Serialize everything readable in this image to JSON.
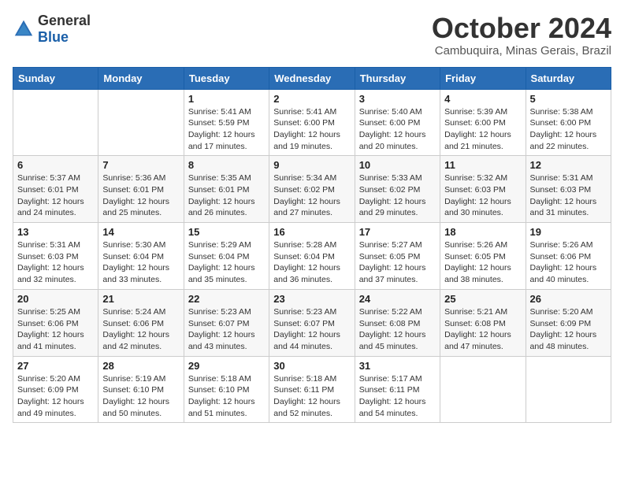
{
  "logo": {
    "general": "General",
    "blue": "Blue"
  },
  "title": "October 2024",
  "location": "Cambuquira, Minas Gerais, Brazil",
  "headers": [
    "Sunday",
    "Monday",
    "Tuesday",
    "Wednesday",
    "Thursday",
    "Friday",
    "Saturday"
  ],
  "weeks": [
    [
      {
        "day": "",
        "detail": ""
      },
      {
        "day": "",
        "detail": ""
      },
      {
        "day": "1",
        "detail": "Sunrise: 5:41 AM\nSunset: 5:59 PM\nDaylight: 12 hours and 17 minutes."
      },
      {
        "day": "2",
        "detail": "Sunrise: 5:41 AM\nSunset: 6:00 PM\nDaylight: 12 hours and 19 minutes."
      },
      {
        "day": "3",
        "detail": "Sunrise: 5:40 AM\nSunset: 6:00 PM\nDaylight: 12 hours and 20 minutes."
      },
      {
        "day": "4",
        "detail": "Sunrise: 5:39 AM\nSunset: 6:00 PM\nDaylight: 12 hours and 21 minutes."
      },
      {
        "day": "5",
        "detail": "Sunrise: 5:38 AM\nSunset: 6:00 PM\nDaylight: 12 hours and 22 minutes."
      }
    ],
    [
      {
        "day": "6",
        "detail": "Sunrise: 5:37 AM\nSunset: 6:01 PM\nDaylight: 12 hours and 24 minutes."
      },
      {
        "day": "7",
        "detail": "Sunrise: 5:36 AM\nSunset: 6:01 PM\nDaylight: 12 hours and 25 minutes."
      },
      {
        "day": "8",
        "detail": "Sunrise: 5:35 AM\nSunset: 6:01 PM\nDaylight: 12 hours and 26 minutes."
      },
      {
        "day": "9",
        "detail": "Sunrise: 5:34 AM\nSunset: 6:02 PM\nDaylight: 12 hours and 27 minutes."
      },
      {
        "day": "10",
        "detail": "Sunrise: 5:33 AM\nSunset: 6:02 PM\nDaylight: 12 hours and 29 minutes."
      },
      {
        "day": "11",
        "detail": "Sunrise: 5:32 AM\nSunset: 6:03 PM\nDaylight: 12 hours and 30 minutes."
      },
      {
        "day": "12",
        "detail": "Sunrise: 5:31 AM\nSunset: 6:03 PM\nDaylight: 12 hours and 31 minutes."
      }
    ],
    [
      {
        "day": "13",
        "detail": "Sunrise: 5:31 AM\nSunset: 6:03 PM\nDaylight: 12 hours and 32 minutes."
      },
      {
        "day": "14",
        "detail": "Sunrise: 5:30 AM\nSunset: 6:04 PM\nDaylight: 12 hours and 33 minutes."
      },
      {
        "day": "15",
        "detail": "Sunrise: 5:29 AM\nSunset: 6:04 PM\nDaylight: 12 hours and 35 minutes."
      },
      {
        "day": "16",
        "detail": "Sunrise: 5:28 AM\nSunset: 6:04 PM\nDaylight: 12 hours and 36 minutes."
      },
      {
        "day": "17",
        "detail": "Sunrise: 5:27 AM\nSunset: 6:05 PM\nDaylight: 12 hours and 37 minutes."
      },
      {
        "day": "18",
        "detail": "Sunrise: 5:26 AM\nSunset: 6:05 PM\nDaylight: 12 hours and 38 minutes."
      },
      {
        "day": "19",
        "detail": "Sunrise: 5:26 AM\nSunset: 6:06 PM\nDaylight: 12 hours and 40 minutes."
      }
    ],
    [
      {
        "day": "20",
        "detail": "Sunrise: 5:25 AM\nSunset: 6:06 PM\nDaylight: 12 hours and 41 minutes."
      },
      {
        "day": "21",
        "detail": "Sunrise: 5:24 AM\nSunset: 6:06 PM\nDaylight: 12 hours and 42 minutes."
      },
      {
        "day": "22",
        "detail": "Sunrise: 5:23 AM\nSunset: 6:07 PM\nDaylight: 12 hours and 43 minutes."
      },
      {
        "day": "23",
        "detail": "Sunrise: 5:23 AM\nSunset: 6:07 PM\nDaylight: 12 hours and 44 minutes."
      },
      {
        "day": "24",
        "detail": "Sunrise: 5:22 AM\nSunset: 6:08 PM\nDaylight: 12 hours and 45 minutes."
      },
      {
        "day": "25",
        "detail": "Sunrise: 5:21 AM\nSunset: 6:08 PM\nDaylight: 12 hours and 47 minutes."
      },
      {
        "day": "26",
        "detail": "Sunrise: 5:20 AM\nSunset: 6:09 PM\nDaylight: 12 hours and 48 minutes."
      }
    ],
    [
      {
        "day": "27",
        "detail": "Sunrise: 5:20 AM\nSunset: 6:09 PM\nDaylight: 12 hours and 49 minutes."
      },
      {
        "day": "28",
        "detail": "Sunrise: 5:19 AM\nSunset: 6:10 PM\nDaylight: 12 hours and 50 minutes."
      },
      {
        "day": "29",
        "detail": "Sunrise: 5:18 AM\nSunset: 6:10 PM\nDaylight: 12 hours and 51 minutes."
      },
      {
        "day": "30",
        "detail": "Sunrise: 5:18 AM\nSunset: 6:11 PM\nDaylight: 12 hours and 52 minutes."
      },
      {
        "day": "31",
        "detail": "Sunrise: 5:17 AM\nSunset: 6:11 PM\nDaylight: 12 hours and 54 minutes."
      },
      {
        "day": "",
        "detail": ""
      },
      {
        "day": "",
        "detail": ""
      }
    ]
  ]
}
